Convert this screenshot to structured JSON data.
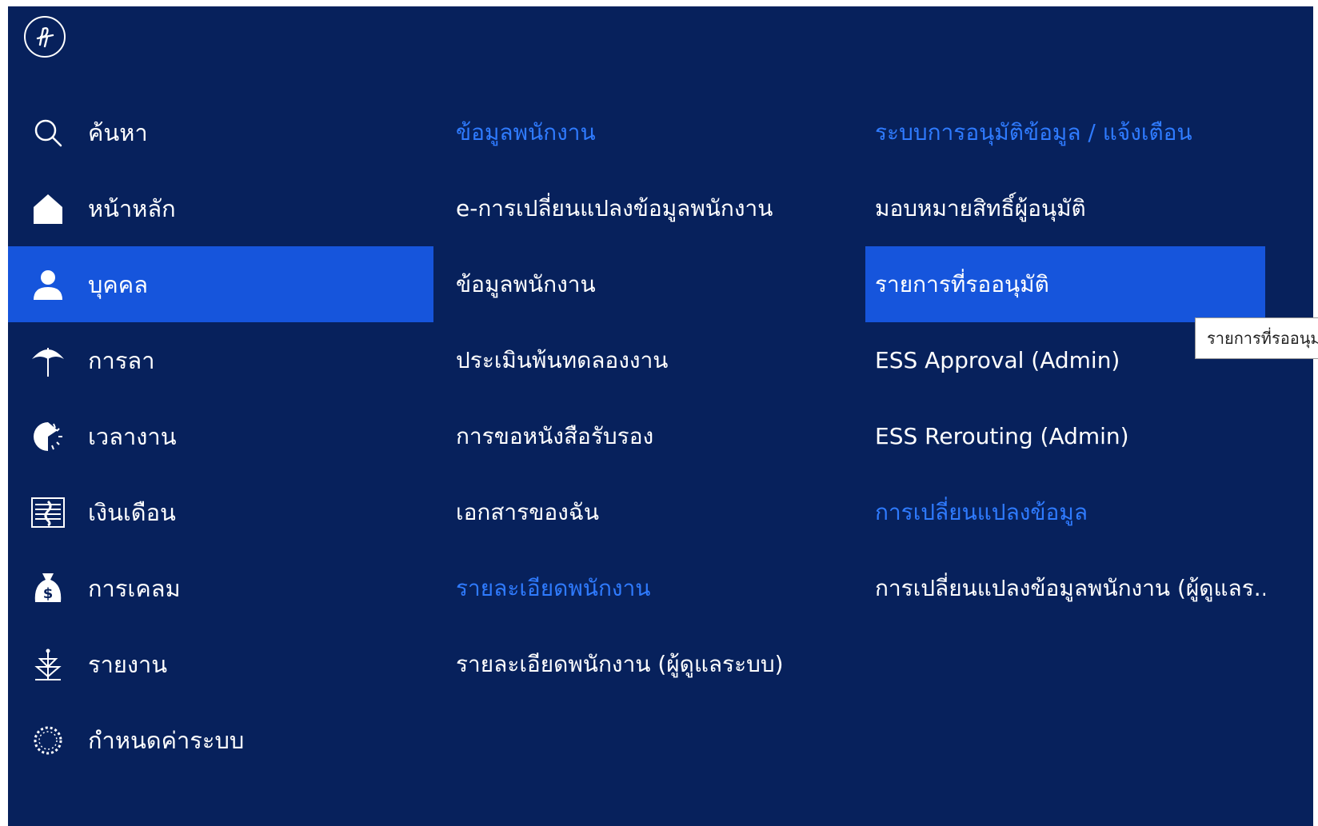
{
  "nav": {
    "items": [
      {
        "label": "ค้นหา",
        "icon": "search-icon"
      },
      {
        "label": "หน้าหลัก",
        "icon": "home-icon"
      },
      {
        "label": "บุคคล",
        "icon": "person-icon",
        "active": true
      },
      {
        "label": "การลา",
        "icon": "umbrella-icon"
      },
      {
        "label": "เวลางาน",
        "icon": "clock-icon"
      },
      {
        "label": "เงินเดือน",
        "icon": "salary-icon"
      },
      {
        "label": "การเคลม",
        "icon": "money-bag-icon"
      },
      {
        "label": "รายงาน",
        "icon": "report-icon"
      },
      {
        "label": "กำหนดค่าระบบ",
        "icon": "settings-icon"
      }
    ]
  },
  "middle": {
    "items": [
      {
        "label": "ข้อมูลพนักงาน",
        "type": "heading"
      },
      {
        "label": "e-การเปลี่ยนแปลงข้อมูลพนักงาน",
        "type": "link"
      },
      {
        "label": "ข้อมูลพนักงาน",
        "type": "link"
      },
      {
        "label": "ประเมินพ้นทดลองงาน",
        "type": "link"
      },
      {
        "label": "การขอหนังสือรับรอง",
        "type": "link"
      },
      {
        "label": "เอกสารของฉัน",
        "type": "link"
      },
      {
        "label": "รายละเอียดพนักงาน",
        "type": "heading"
      },
      {
        "label": "รายละเอียดพนักงาน (ผู้ดูแลระบบ)",
        "type": "link"
      }
    ]
  },
  "right": {
    "items": [
      {
        "label": "ระบบการอนุมัติข้อมูล / แจ้งเตือน",
        "type": "heading"
      },
      {
        "label": "มอบหมายสิทธิ์ผู้อนุมัติ",
        "type": "link"
      },
      {
        "label": "รายการที่รออนุมัติ",
        "type": "link",
        "active": true
      },
      {
        "label": "ESS Approval (Admin)",
        "type": "link"
      },
      {
        "label": "ESS Rerouting (Admin)",
        "type": "link"
      },
      {
        "label": "การเปลี่ยนแปลงข้อมูล",
        "type": "heading"
      },
      {
        "label": "การเปลี่ยนแปลงข้อมูลพนักงาน (ผู้ดูแลร...",
        "type": "link"
      }
    ]
  },
  "tooltip": {
    "text": "รายการที่รออนุม"
  },
  "colors": {
    "background": "#07215c",
    "active": "#1655dc",
    "heading": "#2f7bff",
    "text": "#ffffff"
  }
}
